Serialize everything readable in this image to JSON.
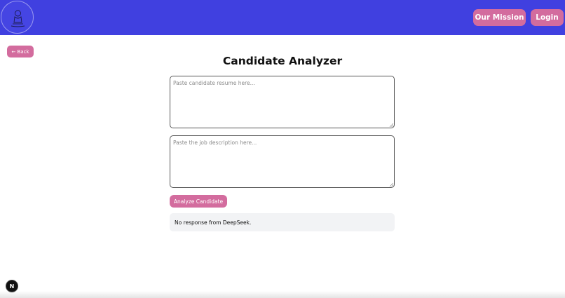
{
  "header": {
    "mission_label": "Our Mission",
    "login_label": "Login"
  },
  "back_label": "← Back",
  "page_title": "Candidate Analyzer",
  "resume": {
    "value": "",
    "placeholder": "Paste candidate resume here..."
  },
  "job": {
    "value": "",
    "placeholder": "Paste the job description here..."
  },
  "analyze_label": "Analyze Candidate",
  "response_text": "No response from DeepSeek.",
  "badge_letter": "N",
  "colors": {
    "header_bg": "#4040e0",
    "accent": "#d36c9e",
    "response_bg": "#f2f3f5"
  }
}
